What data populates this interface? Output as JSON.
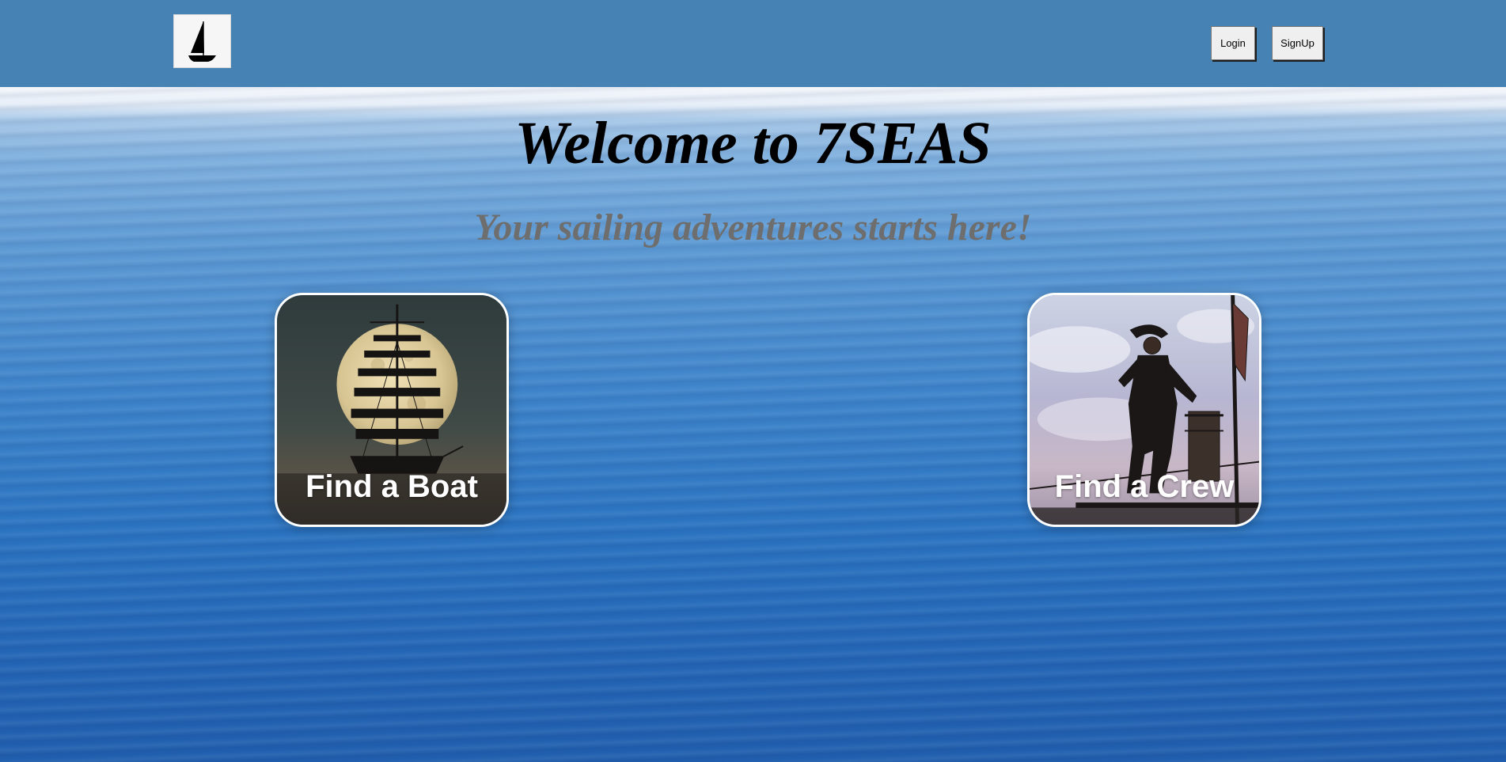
{
  "header": {
    "logo_icon": "sailboat-icon",
    "login_label": "Login",
    "signup_label": "SignUp",
    "background_color": "#4682b4"
  },
  "hero": {
    "title": "Welcome to 7SEAS",
    "subtitle": "Your sailing adventures starts here!"
  },
  "cards": [
    {
      "label": "Find a Boat",
      "image": "ship-moon-image"
    },
    {
      "label": "Find a Crew",
      "image": "pirate-captain-image"
    }
  ]
}
